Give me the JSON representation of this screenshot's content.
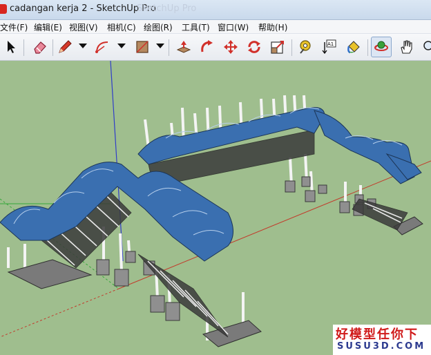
{
  "window": {
    "title": "cadangan kerja 2 - SketchUp Pro",
    "title_ghost": "SketchUp Pro"
  },
  "menu": [
    {
      "label": "文件(F)"
    },
    {
      "label": "编辑(E)"
    },
    {
      "label": "视图(V)"
    },
    {
      "label": "相机(C)"
    },
    {
      "label": "绘图(R)"
    },
    {
      "label": "工具(T)"
    },
    {
      "label": "窗口(W)"
    },
    {
      "label": "帮助(H)"
    }
  ],
  "toolbar": {
    "tools": [
      {
        "name": "select-tool-icon"
      },
      {
        "name": "eraser-tool-icon"
      },
      {
        "name": "pencil-line-tool-icon"
      },
      {
        "name": "arc-tool-icon"
      },
      {
        "name": "rectangle-tool-icon"
      },
      {
        "name": "push-pull-tool-icon"
      },
      {
        "name": "follow-me-tool-icon"
      },
      {
        "name": "move-tool-icon"
      },
      {
        "name": "rotate-tool-icon"
      },
      {
        "name": "scale-tool-icon"
      },
      {
        "name": "tape-measure-tool-icon"
      },
      {
        "name": "text-tool-icon"
      },
      {
        "name": "paint-bucket-tool-icon"
      },
      {
        "name": "orbit-tool-icon"
      },
      {
        "name": "pan-tool-icon"
      },
      {
        "name": "zoom-tool-icon"
      }
    ],
    "text_tool_label": "A1",
    "active_tool": "orbit-tool-icon"
  },
  "viewport": {
    "ground_color": "#9fbe8e",
    "sky_color": "#ffffff",
    "roof_color": "#3a6fb0",
    "axis_red": "#c23b2b",
    "axis_green": "#36a83a",
    "axis_blue": "#2f3cc9"
  },
  "watermark": {
    "line1": "好模型任你下",
    "line2": "SUSU3D.COM"
  }
}
